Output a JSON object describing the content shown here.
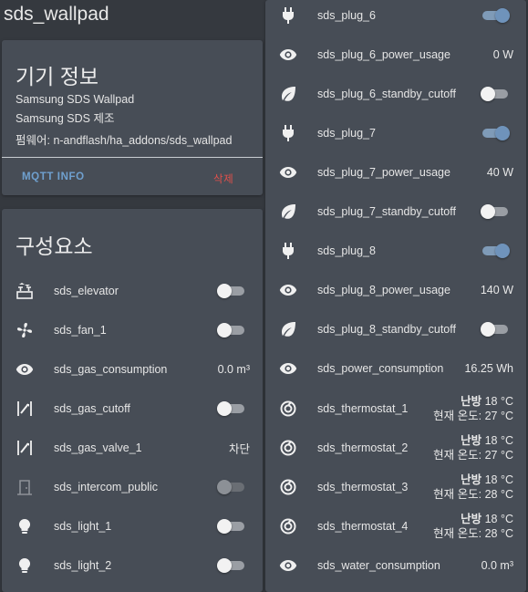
{
  "page": {
    "title": "sds_wallpad"
  },
  "colors": {
    "background": "#35393f",
    "card": "#474d56",
    "accent": "#6f93bb",
    "danger": "#e0504b",
    "link": "#6fa0cf"
  },
  "device_info": {
    "title": "기기 정보",
    "model": "Samsung SDS Wallpad",
    "manufacturer": "Samsung SDS 제조",
    "firmware": "펌웨어: n-andflash/ha_addons/sds_wallpad",
    "mqtt_info_label": "MQTT INFO",
    "delete_label": "삭제"
  },
  "components": {
    "title": "구성요소",
    "items": [
      {
        "name": "sds_elevator",
        "icon": "elevator-icon",
        "toggle": "off"
      },
      {
        "name": "sds_fan_1",
        "icon": "fan-icon",
        "toggle": "off"
      },
      {
        "name": "sds_gas_consumption",
        "icon": "eye-icon",
        "value": "0.0 m³"
      },
      {
        "name": "sds_gas_cutoff",
        "icon": "valve-icon",
        "toggle": "off"
      },
      {
        "name": "sds_gas_valve_1",
        "icon": "valve-icon",
        "value": "차단"
      },
      {
        "name": "sds_intercom_public",
        "icon": "door-icon",
        "toggle": "disabled"
      },
      {
        "name": "sds_light_1",
        "icon": "bulb-icon",
        "toggle": "off"
      },
      {
        "name": "sds_light_2",
        "icon": "bulb-icon",
        "toggle": "off"
      }
    ]
  },
  "entities": [
    {
      "name": "sds_plug_6",
      "icon": "plug-icon",
      "toggle": "on"
    },
    {
      "name": "sds_plug_6_power_usage",
      "icon": "eye-icon",
      "value": "0 W"
    },
    {
      "name": "sds_plug_6_standby_cutoff",
      "icon": "leaf-icon",
      "toggle": "off"
    },
    {
      "name": "sds_plug_7",
      "icon": "plug-icon",
      "toggle": "on"
    },
    {
      "name": "sds_plug_7_power_usage",
      "icon": "eye-icon",
      "value": "40 W"
    },
    {
      "name": "sds_plug_7_standby_cutoff",
      "icon": "leaf-icon",
      "toggle": "off"
    },
    {
      "name": "sds_plug_8",
      "icon": "plug-icon",
      "toggle": "on"
    },
    {
      "name": "sds_plug_8_power_usage",
      "icon": "eye-icon",
      "value": "140 W"
    },
    {
      "name": "sds_plug_8_standby_cutoff",
      "icon": "leaf-icon",
      "toggle": "off"
    },
    {
      "name": "sds_power_consumption",
      "icon": "eye-icon",
      "value": "16.25 Wh"
    },
    {
      "name": "sds_thermostat_1",
      "icon": "thermostat-icon",
      "mode": "난방",
      "target": "18 °C",
      "current": "현재 온도: 27 °C"
    },
    {
      "name": "sds_thermostat_2",
      "icon": "thermostat-icon",
      "mode": "난방",
      "target": "18 °C",
      "current": "현재 온도: 27 °C"
    },
    {
      "name": "sds_thermostat_3",
      "icon": "thermostat-icon",
      "mode": "난방",
      "target": "18 °C",
      "current": "현재 온도: 28 °C"
    },
    {
      "name": "sds_thermostat_4",
      "icon": "thermostat-icon",
      "mode": "난방",
      "target": "18 °C",
      "current": "현재 온도: 28 °C"
    },
    {
      "name": "sds_water_consumption",
      "icon": "eye-icon",
      "value": "0.0 m³"
    }
  ]
}
